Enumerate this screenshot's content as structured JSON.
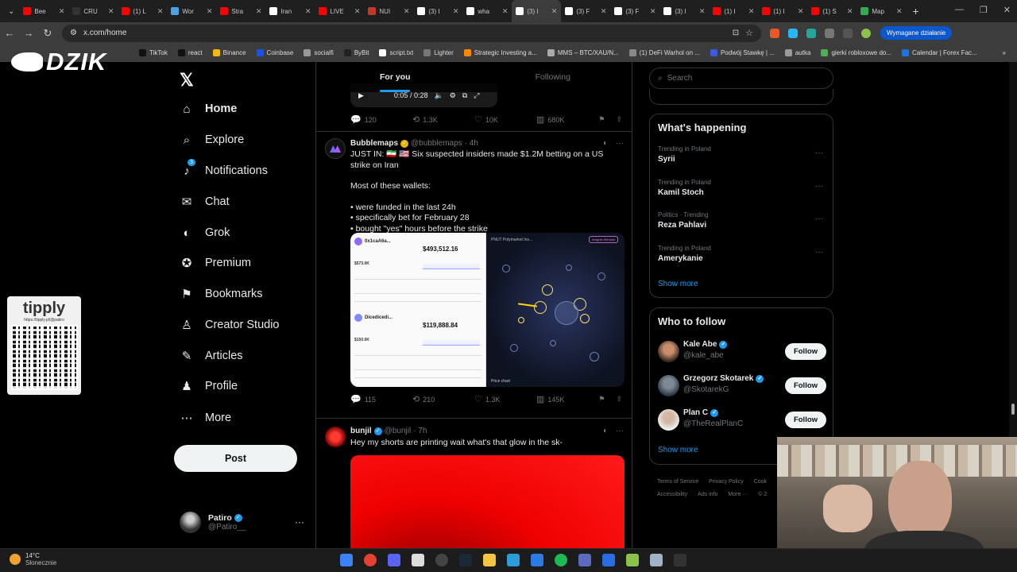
{
  "browser": {
    "tabs": [
      {
        "label": "Bee",
        "icon": "youtube-icon",
        "color": "#ff0000"
      },
      {
        "label": "CRU",
        "icon": "tradingview-icon",
        "color": "#333333"
      },
      {
        "label": "(1) L",
        "icon": "youtube-icon",
        "color": "#ff0000"
      },
      {
        "label": "Wor",
        "icon": "arrow-icon",
        "color": "#4aa3df"
      },
      {
        "label": "Stra",
        "icon": "youtube-icon",
        "color": "#ff0000"
      },
      {
        "label": "Iran",
        "icon": "polymarket-icon",
        "color": "#ffffff"
      },
      {
        "label": "LIVE",
        "icon": "youtube-icon",
        "color": "#ff0000"
      },
      {
        "label": "NUI",
        "icon": "image-icon",
        "color": "#c0392b"
      },
      {
        "label": "(3) I",
        "icon": "x-icon",
        "color": "#ffffff"
      },
      {
        "label": "wha",
        "icon": "google-icon",
        "color": "#ffffff"
      },
      {
        "label": "(3) I",
        "icon": "x-icon",
        "color": "#ffffff",
        "active": true
      },
      {
        "label": "(3) F",
        "icon": "x-icon",
        "color": "#ffffff"
      },
      {
        "label": "(3) F",
        "icon": "x-icon",
        "color": "#ffffff"
      },
      {
        "label": "(3) I",
        "icon": "x-icon",
        "color": "#ffffff"
      },
      {
        "label": "(1) I",
        "icon": "youtube-icon",
        "color": "#ff0000"
      },
      {
        "label": "(1) I",
        "icon": "youtube-icon",
        "color": "#ff0000"
      },
      {
        "label": "(1) S",
        "icon": "youtube-icon",
        "color": "#ff0000"
      },
      {
        "label": "Map",
        "icon": "maps-icon",
        "color": "#34a853"
      }
    ],
    "url": "x.com/home",
    "action_button": "Wymagane działanie",
    "bookmarks": [
      "TikTok",
      "react",
      "Binance",
      "Coinbase",
      "socialfi",
      "ByBit",
      "script.txt",
      "Lighter",
      "Strategic Investing a...",
      "MMS – BTC/XAU/N...",
      "(1) DeFi Warhol on ...",
      "Podwój Stawkę | ...",
      "autka",
      "gierki robloxowe do...",
      "Calendar | Forex Fac..."
    ]
  },
  "overlay": {
    "logo_text": "DZIK",
    "tipply_logo": "tipply",
    "tipply_url": "https://tipply.pl/@patiro"
  },
  "nav": {
    "items": [
      {
        "label": "Home",
        "icon": "home-icon",
        "glyph": "⌂",
        "bold": true
      },
      {
        "label": "Explore",
        "icon": "search-icon",
        "glyph": "⌕"
      },
      {
        "label": "Notifications",
        "icon": "bell-icon",
        "glyph": "♪",
        "badge": "3"
      },
      {
        "label": "Chat",
        "icon": "mail-icon",
        "glyph": "✉"
      },
      {
        "label": "Grok",
        "icon": "grok-icon",
        "glyph": "◐"
      },
      {
        "label": "Premium",
        "icon": "premium-icon",
        "glyph": "✪"
      },
      {
        "label": "Bookmarks",
        "icon": "bookmark-icon",
        "glyph": "⚑"
      },
      {
        "label": "Creator Studio",
        "icon": "creator-studio-icon",
        "glyph": "♙"
      },
      {
        "label": "Articles",
        "icon": "articles-icon",
        "glyph": "✎"
      },
      {
        "label": "Profile",
        "icon": "profile-icon",
        "glyph": "♟"
      },
      {
        "label": "More",
        "icon": "more-icon",
        "glyph": "⋯"
      }
    ],
    "post_label": "Post",
    "user": {
      "name": "Patiro",
      "handle": "@Patiro__"
    }
  },
  "feed": {
    "tabs": [
      "For you",
      "Following"
    ],
    "video": {
      "time": "0:05 / 0:28"
    },
    "video_post_stats": {
      "replies": "120",
      "reposts": "1.3K",
      "likes": "10K",
      "views": "680K"
    },
    "post1": {
      "name": "Bubblemaps",
      "handle": "@bubblemaps",
      "time": "· 4h",
      "text_line1": "JUST IN: 🇮🇷 🇺🇸 Six suspected insiders made $1.2M betting on a US strike on Iran",
      "text_line2": "Most of these wallets:",
      "bullets": [
        "• were funded in the last 24h",
        "• specifically bet for February 28",
        "• bought \"yes\" hours before the strike"
      ],
      "stats": {
        "replies": "115",
        "reposts": "210",
        "likes": "1.3K",
        "views": "145K"
      },
      "media": {
        "wallet1": "0x1caA6a...",
        "wallet1_value": "$493,512.16",
        "wallet1_sub": "$573.0K",
        "wallet2": "Dicedicedi...",
        "wallet2_value": "$119,888.84",
        "wallet2_sub": "$150.0K",
        "bubble_caption": "Price chart",
        "bubble_header": "PNUT Polymarket Ins...",
        "bubble_pill": "Insights Window"
      }
    },
    "post2": {
      "name": "bunjil",
      "handle": "@bunjil",
      "time": "· 7h",
      "text": "Hey my shorts are printing wait what's that glow in the sk-"
    }
  },
  "sidebar": {
    "search_placeholder": "Search",
    "whats_happening": "What's happening",
    "trends": [
      {
        "category": "Trending in Poland",
        "name": "Syrii"
      },
      {
        "category": "Trending in Poland",
        "name": "Kamil Stoch"
      },
      {
        "category": "Politics · Trending",
        "name": "Reza Pahlavi"
      },
      {
        "category": "Trending in Poland",
        "name": "Amerykanie"
      }
    ],
    "show_more": "Show more",
    "who_to_follow": "Who to follow",
    "suggestions": [
      {
        "name": "Kale Abe",
        "handle": "@kale_abe",
        "verified": true
      },
      {
        "name": "Grzegorz Skotarek",
        "handle": "@SkotarekG",
        "verified": true
      },
      {
        "name": "Plan C",
        "handle": "@TheRealPlanC",
        "verified": true
      }
    ],
    "follow_label": "Follow",
    "show_more2": "Show more",
    "footer": [
      "Terms of Service",
      "Privacy Policy",
      "Cook",
      "Accessibility",
      "Ads info",
      "More ···",
      "© 2"
    ]
  },
  "taskbar": {
    "temperature": "14°C",
    "condition": "Słonecznie",
    "apps": [
      "windows-icon",
      "chrome-icon",
      "discord-icon",
      "app-icon",
      "obs-icon",
      "steam-icon",
      "explorer-icon",
      "edge-icon",
      "vscode-icon",
      "spotify-icon",
      "app-icon",
      "capcut-icon",
      "app-icon",
      "notepad-icon",
      "terminal-icon"
    ]
  },
  "colors": {
    "accent": "#1d9bf0",
    "background": "#000000",
    "border": "#2f3336",
    "muted": "#71767b"
  }
}
